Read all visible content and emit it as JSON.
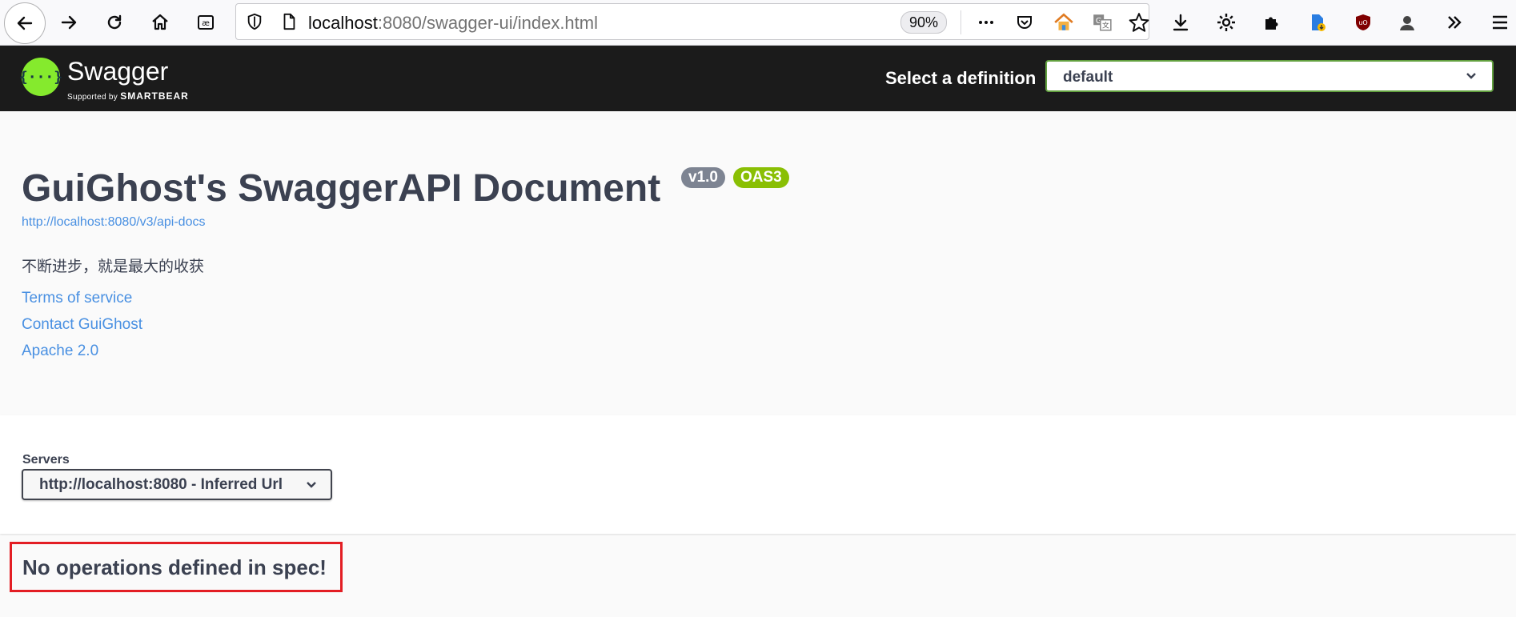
{
  "browser": {
    "url_host": "localhost",
    "url_rest": ":8080/swagger-ui/index.html",
    "zoom": "90%",
    "icons": [
      "back-arrow-icon",
      "forward-arrow-icon",
      "reload-icon",
      "home-icon",
      "reader-icon",
      "shield-icon",
      "page-icon",
      "more-dots-icon",
      "pocket-icon",
      "home-extension-icon",
      "translate-icon",
      "star-icon",
      "download-icon",
      "gear-icon",
      "puzzle-icon",
      "file-extension-icon",
      "ublock-icon",
      "avatar-icon",
      "overflow-chevrons-icon",
      "hamburger-menu-icon"
    ]
  },
  "swagger": {
    "logo_word": "Swagger",
    "logo_sub_prefix": "Supported by",
    "logo_sub_brand": "SMARTBEAR",
    "select_label": "Select a definition",
    "select_value": "default",
    "colors": {
      "topbar": "#1b1b1b",
      "logo": "#85ea2d",
      "accent": "#62a03f"
    }
  },
  "info": {
    "title": "GuiGhost's SwaggerAPI Document",
    "version": "v1.0",
    "oas": "OAS3",
    "api_url": "http://localhost:8080/v3/api-docs",
    "description": "不断进步，就是最大的收获",
    "links": [
      "Terms of service",
      "Contact GuiGhost",
      "Apache 2.0"
    ]
  },
  "servers": {
    "label": "Servers",
    "selected": "http://localhost:8080 - Inferred Url"
  },
  "operations": {
    "message": "No operations defined in spec!",
    "highlight_color": "#e31e24"
  }
}
